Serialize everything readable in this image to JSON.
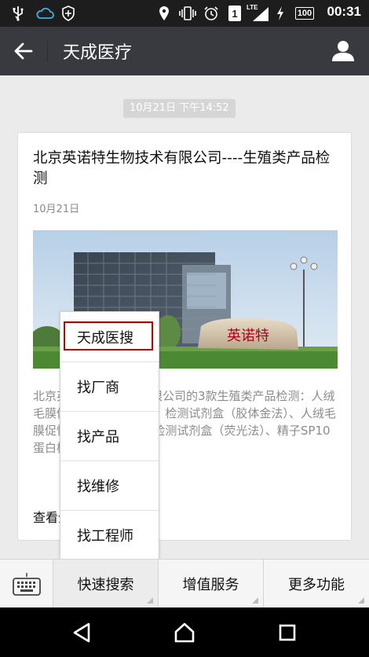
{
  "status_bar": {
    "time": "00:31",
    "battery": "100",
    "sim": "1",
    "network": "LTE",
    "icons": [
      "usb-icon",
      "cloud-icon",
      "shield-icon",
      "location-icon",
      "vibrate-icon",
      "alarm-icon",
      "sim-icon",
      "signal-icon",
      "charging-icon",
      "battery-icon"
    ]
  },
  "header": {
    "title": "天成医疗",
    "back_icon": "arrow-left-icon",
    "profile_icon": "person-icon"
  },
  "message": {
    "timestamp": "10月21日 下午14:52",
    "card": {
      "title": "北京英诺特生物技术有限公司----生殖类产品检测",
      "date": "10月21日",
      "image_sign_text": "英诺特",
      "description": "北京英诺特生物技术有限公司的3款生殖类产品检测：人绒毛膜促性腺激素（HCG）检测试剂盒（胶体金法）、人绒毛膜促性腺激素（HCG）检测试剂盒（荧光法）、精子SP10蛋白检测试剂盒",
      "more_label": "查看全文"
    }
  },
  "popup_menu": {
    "items": [
      {
        "label": "天成医搜"
      },
      {
        "label": "找厂商"
      },
      {
        "label": "找产品"
      },
      {
        "label": "找维修"
      },
      {
        "label": "找工程师"
      }
    ],
    "highlight_color": "#b00000"
  },
  "bottom_menu": {
    "keyboard_icon": "keyboard-icon",
    "items": [
      {
        "label": "快速搜索"
      },
      {
        "label": "增值服务"
      },
      {
        "label": "更多功能"
      }
    ]
  },
  "nav_bar": {
    "icons": [
      "back-triangle-icon",
      "home-icon",
      "recents-icon"
    ]
  },
  "colors": {
    "title_bar": "#393a3f",
    "status_bar": "#1d1d1d",
    "background": "#ebebeb"
  }
}
